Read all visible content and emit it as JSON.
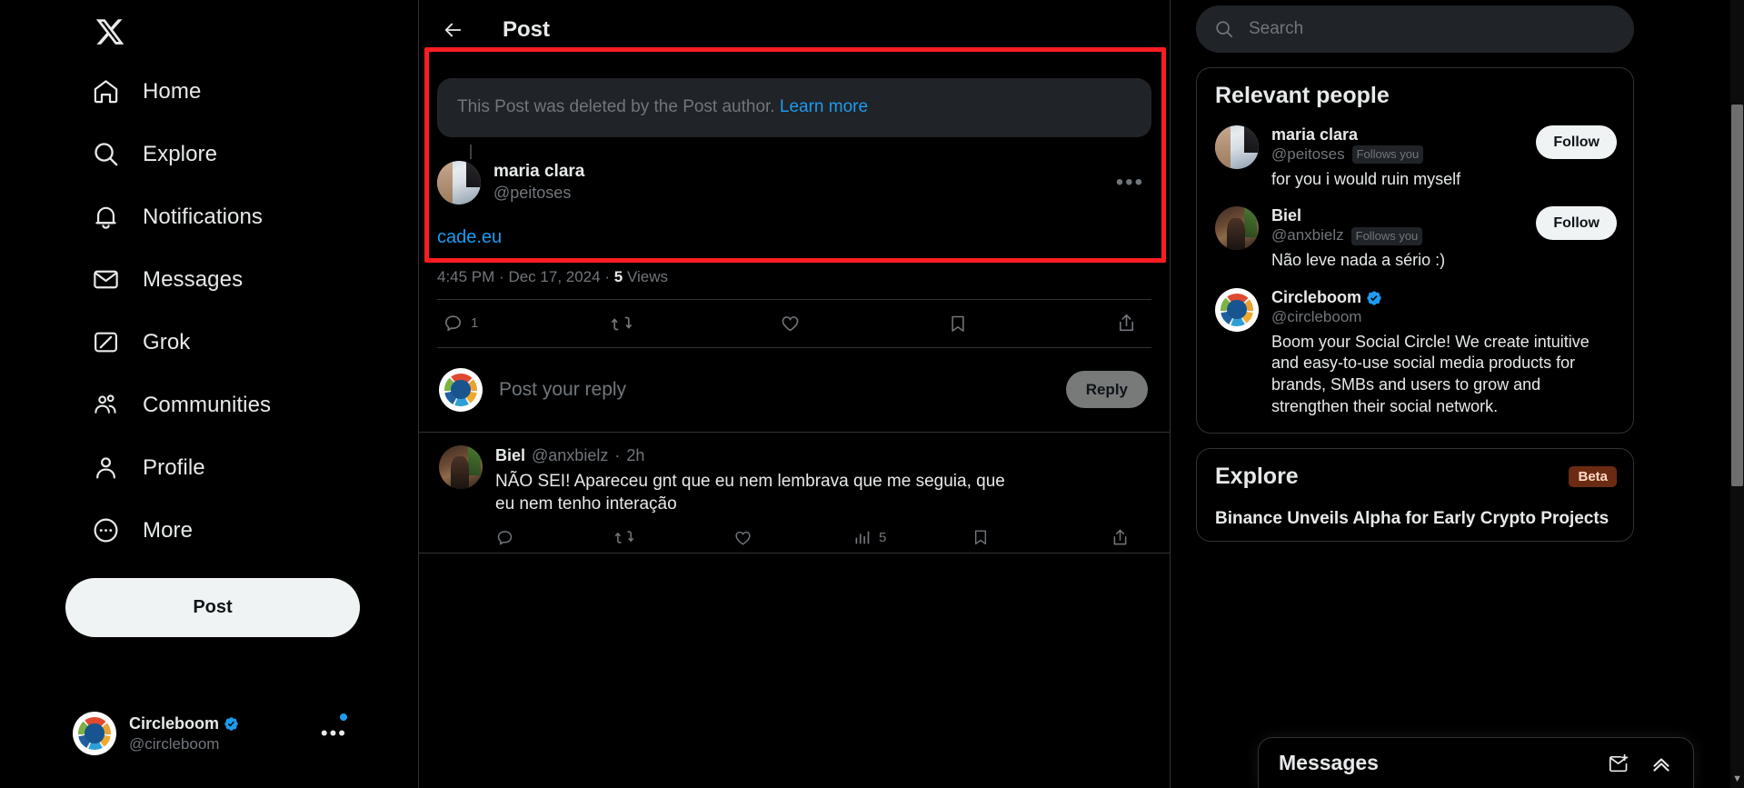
{
  "sidebar": {
    "logo_icon": "x-logo-icon",
    "items": [
      {
        "label": "Home",
        "icon": "home-icon"
      },
      {
        "label": "Explore",
        "icon": "search-icon"
      },
      {
        "label": "Notifications",
        "icon": "bell-icon"
      },
      {
        "label": "Messages",
        "icon": "envelope-icon"
      },
      {
        "label": "Grok",
        "icon": "grok-icon"
      },
      {
        "label": "Communities",
        "icon": "people-icon"
      },
      {
        "label": "Profile",
        "icon": "person-icon"
      },
      {
        "label": "More",
        "icon": "more-circle-icon"
      }
    ],
    "post_button": "Post",
    "account": {
      "name": "Circleboom",
      "handle": "@circleboom",
      "verified": true,
      "menu_icon": "ellipsis-icon"
    }
  },
  "center": {
    "back_icon": "arrow-left-icon",
    "title": "Post",
    "deleted_notice": "This Post was deleted by the Post author.",
    "learn_more": "Learn more",
    "post": {
      "author_name": "maria clara",
      "author_handle": "@peitoses",
      "more_icon": "ellipsis-icon",
      "link_text": "cade.eu",
      "time": "4:45 PM",
      "date": "Dec 17, 2024",
      "views_count": "5",
      "views_label": "Views",
      "separator": "·"
    },
    "actions": [
      {
        "icon": "reply-icon",
        "count": "1"
      },
      {
        "icon": "retweet-icon",
        "count": ""
      },
      {
        "icon": "like-icon",
        "count": ""
      },
      {
        "icon": "bookmark-icon",
        "count": ""
      },
      {
        "icon": "share-icon",
        "count": ""
      }
    ],
    "composer": {
      "placeholder": "Post your reply",
      "reply_button": "Reply"
    },
    "reply": {
      "name": "Biel",
      "handle": "@anxbielz",
      "separator": "·",
      "time": "2h",
      "text": "NÃO SEI! Apareceu gnt que eu nem lembrava que me seguia, que eu nem tenho interação",
      "more_icon": "ellipsis-icon",
      "actions": [
        {
          "icon": "reply-icon",
          "count": ""
        },
        {
          "icon": "retweet-icon",
          "count": ""
        },
        {
          "icon": "like-icon",
          "count": ""
        },
        {
          "icon": "views-icon",
          "count": "5"
        },
        {
          "icon": "bookmark-icon",
          "count": ""
        },
        {
          "icon": "share-icon",
          "count": ""
        }
      ]
    }
  },
  "right": {
    "search": {
      "placeholder": "Search",
      "icon": "search-icon",
      "value": ""
    },
    "relevant_people": {
      "title": "Relevant people",
      "people": [
        {
          "name": "maria clara",
          "handle": "@peitoses",
          "follows_you": "Follows you",
          "verified": false,
          "bio": "for you i would ruin myself",
          "follow_label": "Follow",
          "show_follow": true,
          "avatar": "maria"
        },
        {
          "name": "Biel",
          "handle": "@anxbielz",
          "follows_you": "Follows you",
          "verified": false,
          "bio": "Não leve nada a sério :)",
          "follow_label": "Follow",
          "show_follow": true,
          "avatar": "biel"
        },
        {
          "name": "Circleboom",
          "handle": "@circleboom",
          "follows_you": "",
          "verified": true,
          "bio": "Boom your Social Circle! We create intuitive and easy-to-use social media products for brands, SMBs and users to grow and strengthen their social network.",
          "follow_label": "",
          "show_follow": false,
          "avatar": "circleboom"
        }
      ]
    },
    "explore": {
      "title": "Explore",
      "badge": "Beta",
      "items": [
        {
          "headline": "Binance Unveils Alpha for Early Crypto Projects"
        }
      ]
    },
    "messages_dock": {
      "title": "Messages",
      "new_message_icon": "new-message-icon",
      "expand_icon": "chevron-up-icon"
    }
  },
  "colors": {
    "accent": "#1d9bf0",
    "highlight": "#ff1c22",
    "background": "#000000",
    "border": "#2f3336",
    "muted": "#71767b",
    "beta_badge_bg": "#6b2b12"
  }
}
